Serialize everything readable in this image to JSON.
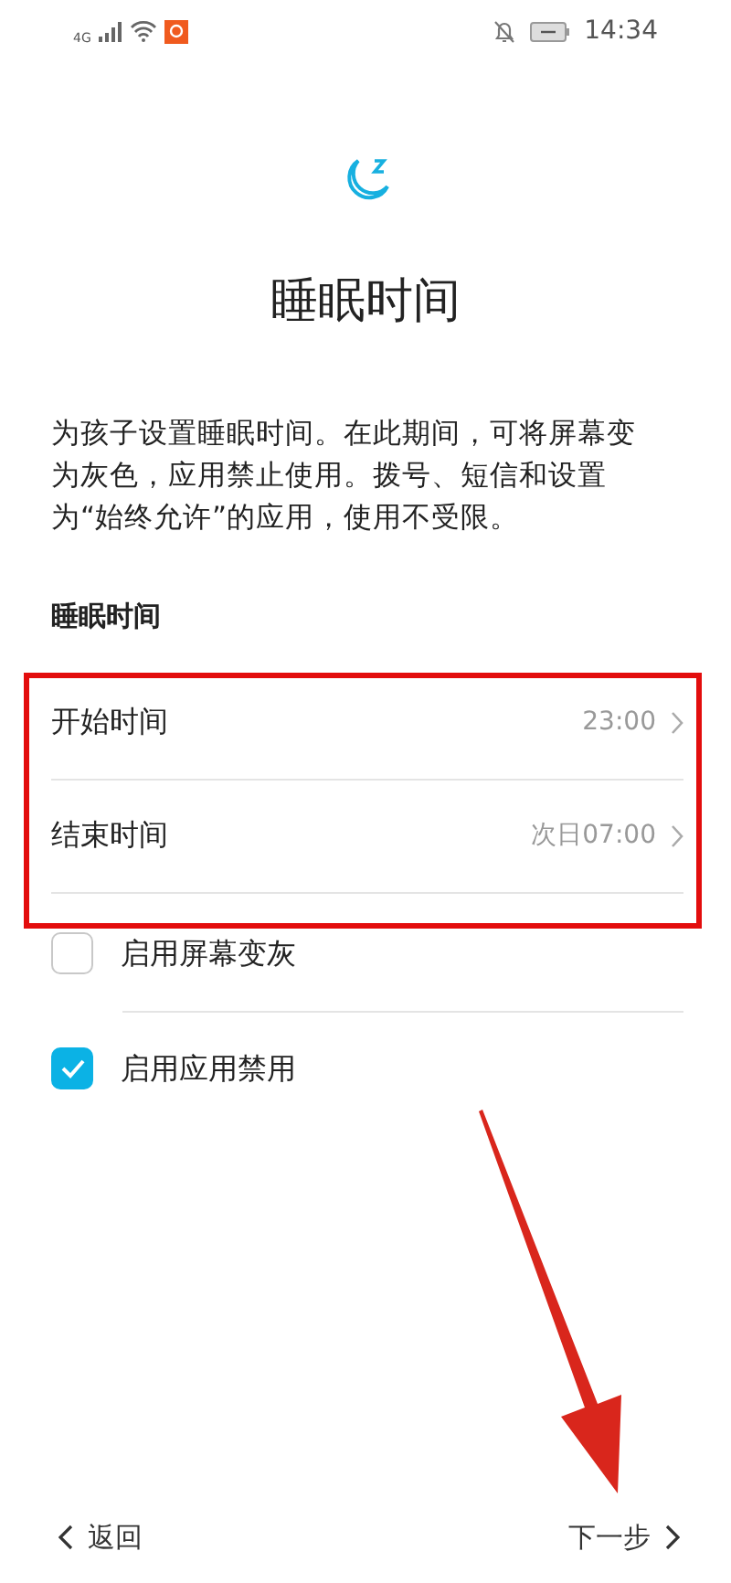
{
  "status_bar": {
    "network": "4G",
    "time": "14:34"
  },
  "title": "睡眠时间",
  "description": "为孩子设置睡眠时间。在此期间，可将屏幕变为灰色，应用禁止使用。拨号、短信和设置为“始终允许”的应用，使用不受限。",
  "section_header": "睡眠时间",
  "time_rows": [
    {
      "label": "开始时间",
      "value": "23:00"
    },
    {
      "label": "结束时间",
      "value": "次日07:00"
    }
  ],
  "options": [
    {
      "label": "启用屏幕变灰",
      "checked": false
    },
    {
      "label": "启用应用禁用",
      "checked": true
    }
  ],
  "footer": {
    "back": "返回",
    "next": "下一步"
  }
}
